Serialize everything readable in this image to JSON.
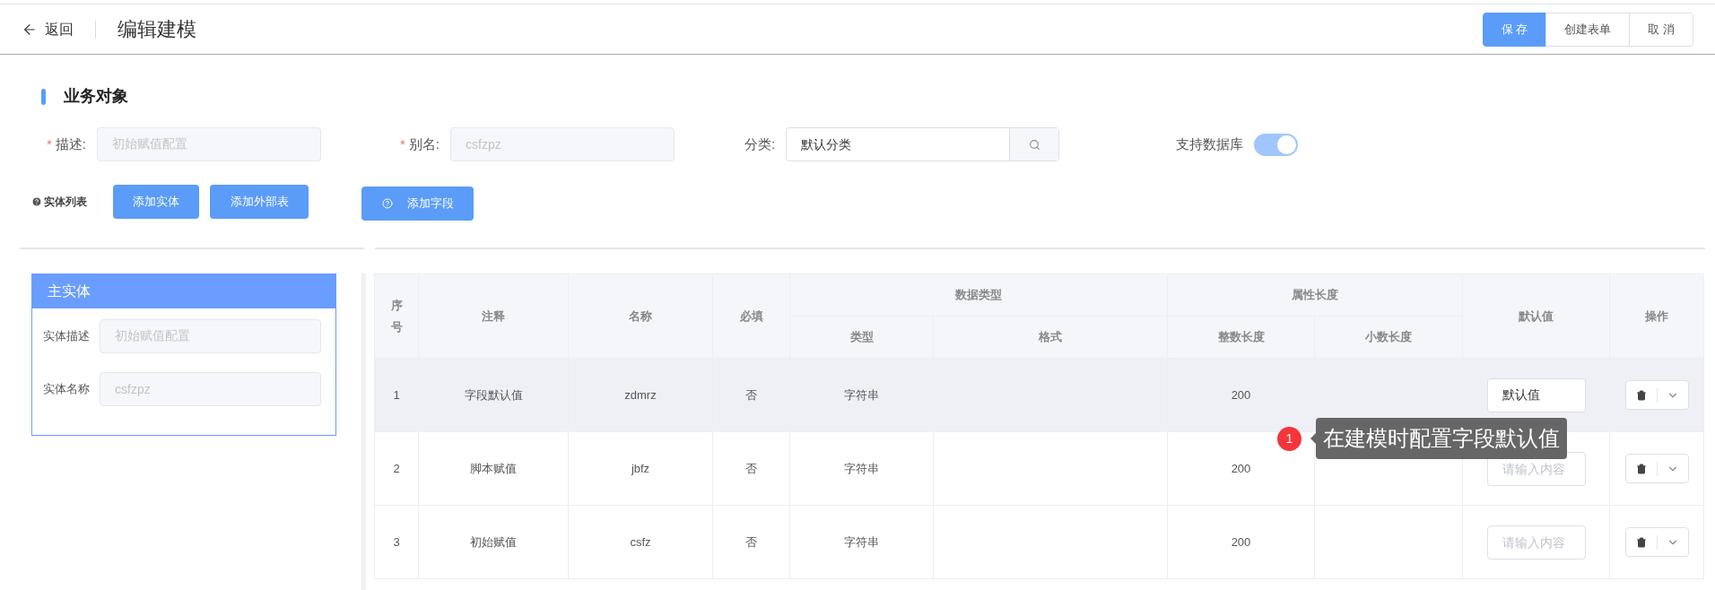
{
  "header": {
    "back": "返回",
    "title": "编辑建模",
    "buttons": [
      {
        "label": "保 存",
        "primary": true
      },
      {
        "label": "创建表单",
        "primary": false
      },
      {
        "label": "取 消",
        "primary": false
      }
    ]
  },
  "section": {
    "title": "业务对象"
  },
  "form": {
    "description": {
      "marker": "*",
      "label": "描述:",
      "value": "初始赋值配置"
    },
    "alias": {
      "marker": "*",
      "label": "别名:",
      "value": "csfzpz"
    },
    "category": {
      "label": "分类:",
      "value": "默认分类"
    },
    "database": {
      "label": "支持数据库",
      "on": true
    }
  },
  "entity_list": {
    "label": "实体列表",
    "buttons": [
      "添加实体",
      "添加外部表"
    ]
  },
  "add_field_button": "添加字段",
  "entity_panel": {
    "title": "主实体",
    "fields": [
      {
        "label": "实体描述",
        "value": "初始赋值配置"
      },
      {
        "label": "实体名称",
        "value": "csfzpz"
      }
    ]
  },
  "table": {
    "columns": [
      {
        "label": "序号"
      },
      {
        "label": "注释"
      },
      {
        "label": "名称"
      },
      {
        "label": "必填"
      },
      {
        "label": "数据类型",
        "children": [
          {
            "label": "类型"
          },
          {
            "label": "格式"
          }
        ]
      },
      {
        "label": "属性长度",
        "children": [
          {
            "label": "整数长度"
          },
          {
            "label": "小数长度"
          }
        ]
      },
      {
        "label": "默认值"
      },
      {
        "label": "操作"
      }
    ],
    "rows": [
      {
        "index": "1",
        "note": "字段默认值",
        "name": "zdmrz",
        "required": "否",
        "type": "字符串",
        "int_length": "200",
        "default": {
          "value": "默认值"
        },
        "highlighted": true
      },
      {
        "index": "2",
        "note": "脚本赋值",
        "name": "jbfz",
        "required": "否",
        "type": "字符串",
        "int_length": "200",
        "default": {
          "placeholder": "请输入内容"
        },
        "highlighted": false
      },
      {
        "index": "3",
        "note": "初始赋值",
        "name": "csfz",
        "required": "否",
        "type": "字符串",
        "int_length": "200",
        "default": {
          "placeholder": "请输入内容"
        },
        "highlighted": false
      }
    ]
  },
  "annotation": {
    "badge": "1",
    "text": "在建模时配置字段默认值"
  }
}
